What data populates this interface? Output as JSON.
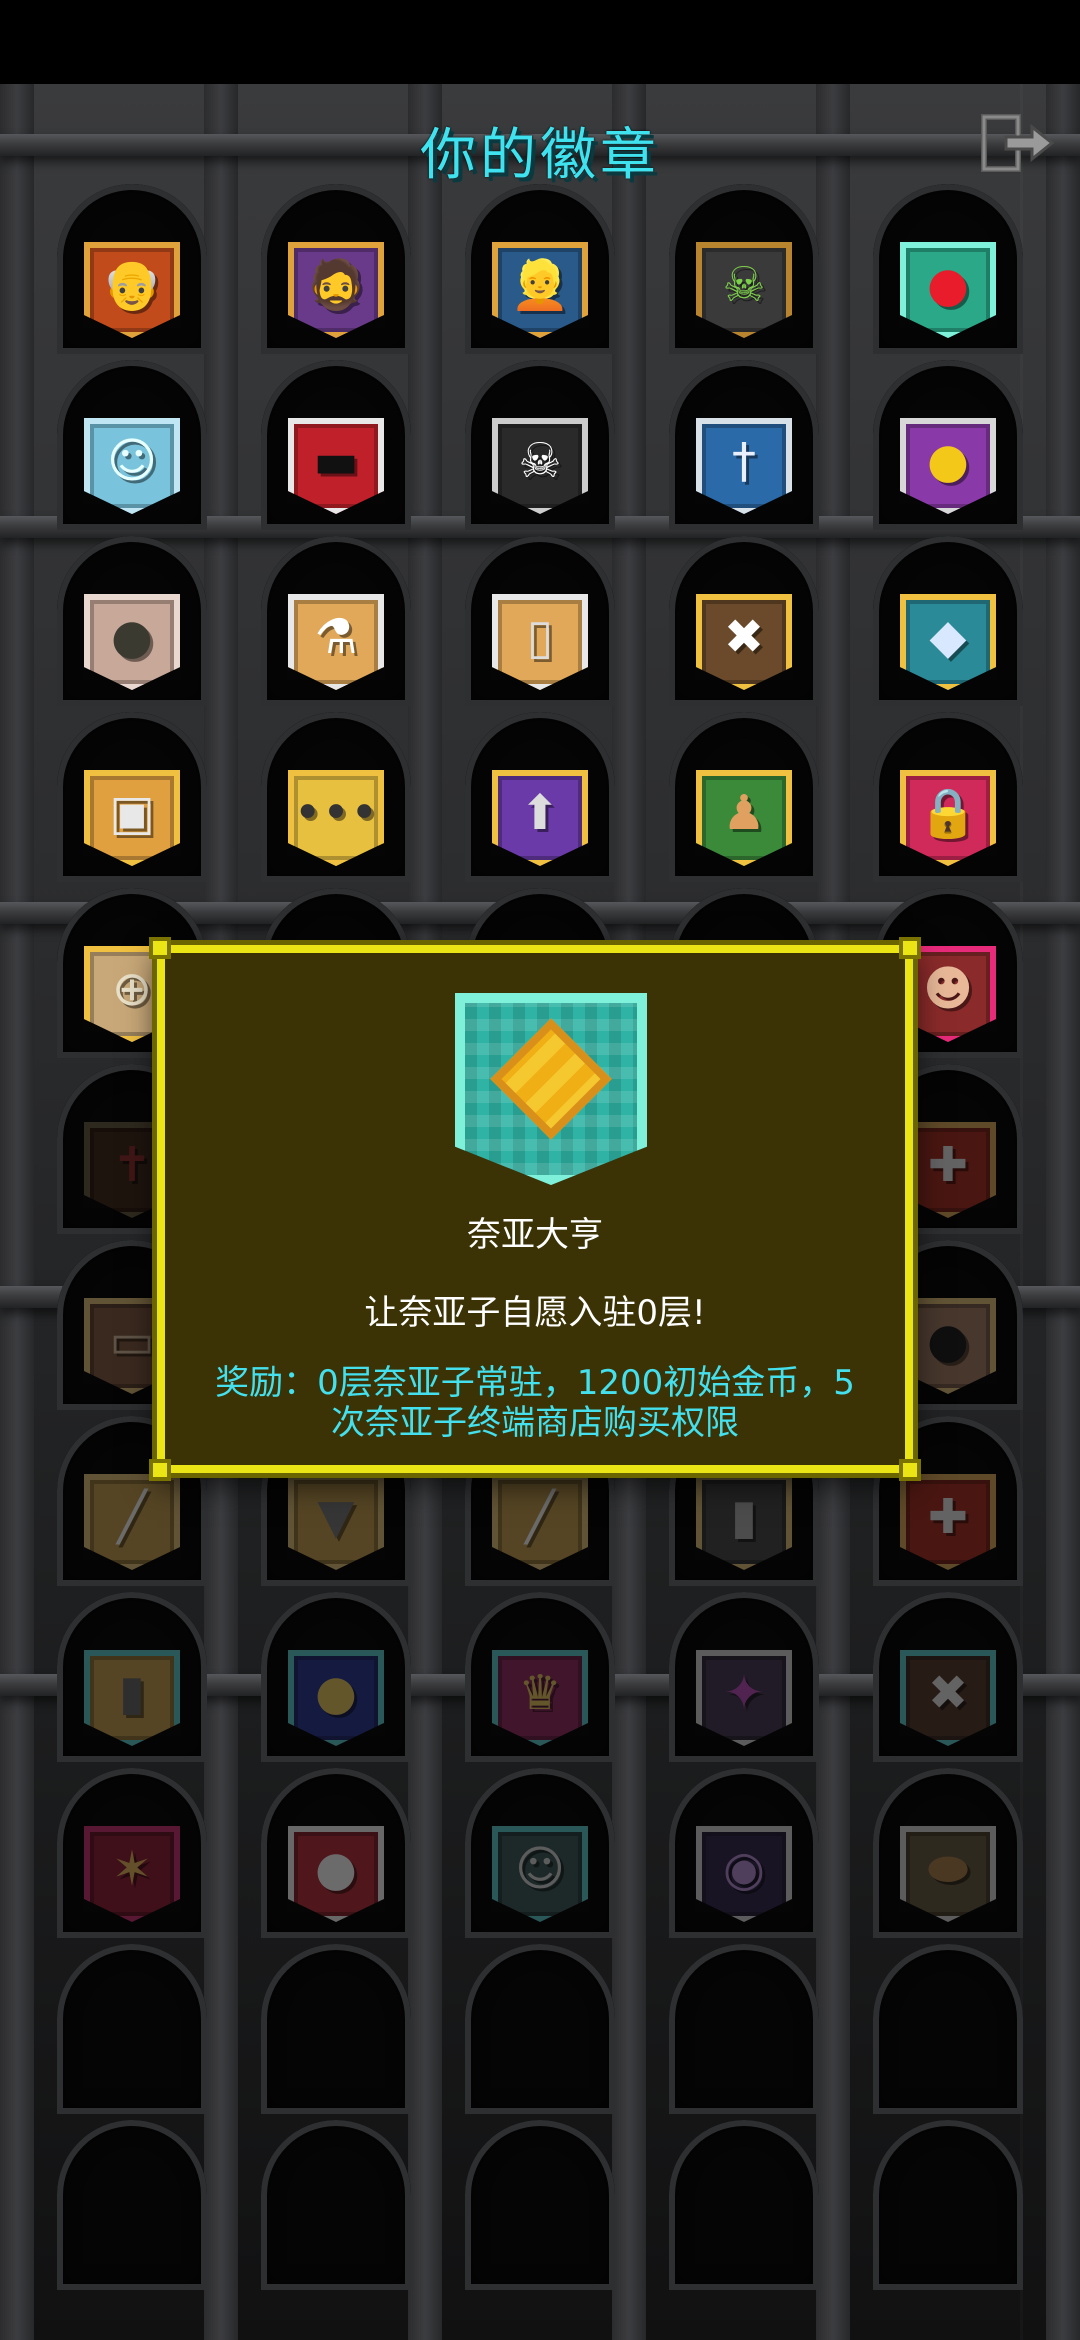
{
  "header": {
    "title": "你的徽章",
    "exit_icon": "exit-door-icon"
  },
  "badges": [
    {
      "name": "badge-old-man",
      "glyph": "👴",
      "frame": "#e0a23a",
      "fill": "#c24b1c",
      "glyph_color": "#ffffff",
      "dim": false
    },
    {
      "name": "badge-rogue",
      "glyph": "🧔",
      "frame": "#e0a23a",
      "fill": "#6a3a8a",
      "glyph_color": "#f4c890",
      "dim": false
    },
    {
      "name": "badge-hero",
      "glyph": "👱",
      "frame": "#e0a23a",
      "fill": "#2a5a8a",
      "glyph_color": "#f0d070",
      "dim": false
    },
    {
      "name": "badge-ghoul",
      "glyph": "☠",
      "frame": "#b8842e",
      "fill": "#3a3a3a",
      "glyph_color": "#7ccf4a",
      "dim": false
    },
    {
      "name": "badge-health-potion",
      "glyph": "●",
      "frame": "#7ff0d9",
      "fill": "#2aa888",
      "glyph_color": "#e81c2a",
      "dim": false
    },
    {
      "name": "badge-ghost",
      "glyph": "☺",
      "frame": "#bfe6f2",
      "fill": "#79c4dc",
      "glyph_color": "#e8ffff",
      "dim": false
    },
    {
      "name": "badge-sunglasses",
      "glyph": "▬",
      "frame": "#e8e8e8",
      "fill": "#c0202a",
      "glyph_color": "#111111",
      "dim": false
    },
    {
      "name": "badge-skull",
      "glyph": "☠",
      "frame": "#cccccc",
      "fill": "#2a2a2a",
      "glyph_color": "#ffffff",
      "dim": false
    },
    {
      "name": "badge-sword",
      "glyph": "†",
      "frame": "#d8e0e8",
      "fill": "#2b6aa8",
      "glyph_color": "#e8f0ff",
      "dim": false
    },
    {
      "name": "badge-gold-coin",
      "glyph": "●",
      "frame": "#d8d8d8",
      "fill": "#8a3aa8",
      "glyph_color": "#f4c818",
      "dim": false
    },
    {
      "name": "badge-pot",
      "glyph": "●",
      "frame": "#e8d8d0",
      "fill": "#c8a898",
      "glyph_color": "#3a3a30",
      "dim": false
    },
    {
      "name": "badge-flask",
      "glyph": "⚗",
      "frame": "#e8e8e8",
      "fill": "#e0a858",
      "glyph_color": "#ffffff",
      "dim": false
    },
    {
      "name": "badge-scroll",
      "glyph": "▯",
      "frame": "#e8e8e8",
      "fill": "#e0a858",
      "glyph_color": "#dddddd",
      "dim": false
    },
    {
      "name": "badge-spider-skull",
      "glyph": "✖",
      "frame": "#f0c040",
      "fill": "#6a4a2a",
      "glyph_color": "#ffffff",
      "dim": false
    },
    {
      "name": "badge-fish",
      "glyph": "◆",
      "frame": "#f0c040",
      "fill": "#2a8a98",
      "glyph_color": "#d8e8ff",
      "dim": false
    },
    {
      "name": "badge-briefcase",
      "glyph": "▣",
      "frame": "#f0c040",
      "fill": "#e0a040",
      "glyph_color": "#e8e8e8",
      "dim": false
    },
    {
      "name": "badge-speech-bubble",
      "glyph": "•••",
      "frame": "#f0c040",
      "fill": "#e8c040",
      "glyph_color": "#333333",
      "dim": false
    },
    {
      "name": "badge-arrow-up",
      "glyph": "⬆",
      "frame": "#f0c040",
      "fill": "#6a3aa8",
      "glyph_color": "#dddddd",
      "dim": false
    },
    {
      "name": "badge-pawn",
      "glyph": "♟",
      "frame": "#f0c040",
      "fill": "#3a8a3a",
      "glyph_color": "#e0a060",
      "dim": false
    },
    {
      "name": "badge-lock",
      "glyph": "🔒",
      "frame": "#f0c040",
      "fill": "#d02a5a",
      "glyph_color": "#444444",
      "dim": false
    },
    {
      "name": "badge-shield-cross",
      "glyph": "⊕",
      "frame": "#f0c040",
      "fill": "#c8a878",
      "glyph_color": "#e8e0c8",
      "dim": false
    },
    {
      "name": "badge-orb",
      "glyph": "●",
      "frame": "#f0c040",
      "fill": "#2a4aa8",
      "glyph_color": "#e88a30",
      "dim": false
    },
    {
      "name": "badge-cloud",
      "glyph": "☁",
      "frame": "#8ed0ee",
      "fill": "#3a8ad0",
      "glyph_color": "#ffffff",
      "dim": false
    },
    {
      "name": "badge-mimic",
      "glyph": "▦",
      "frame": "#44e8e8",
      "fill": "#8a3ad8",
      "glyph_color": "#e82a5a",
      "dim": false
    },
    {
      "name": "badge-warrior",
      "glyph": "☻",
      "frame": "#e82a7a",
      "fill": "#8a2a2a",
      "glyph_color": "#e8b898",
      "dim": false
    },
    {
      "name": "badge-locked-red-figure",
      "glyph": "✝",
      "frame": "#6a5a3a",
      "fill": "#4a2a1a",
      "glyph_color": "#aa2a2a",
      "dim": true
    },
    {
      "name": "badge-locked-skull",
      "glyph": "☠",
      "frame": "#555555",
      "fill": "#2a2a2a",
      "glyph_color": "#aaaaaa",
      "dim": true
    },
    {
      "name": "badge-locked-flame",
      "glyph": "♦",
      "frame": "#a88a3a",
      "fill": "#3a3a3a",
      "glyph_color": "#3ab8d8",
      "dim": true
    },
    {
      "name": "badge-locked-armor",
      "glyph": "▼",
      "frame": "#aaaaaa",
      "fill": "#666666",
      "glyph_color": "#bbbbbb",
      "dim": true
    },
    {
      "name": "badge-locked-cross",
      "glyph": "✚",
      "frame": "#e0a040",
      "fill": "#c02a1a",
      "glyph_color": "#dddddd",
      "dim": true
    },
    {
      "name": "badge-locked-chest",
      "glyph": "▭",
      "frame": "#e0b860",
      "fill": "#8a5a3a",
      "glyph_color": "#d8b890",
      "dim": true
    },
    {
      "name": "badge-locked-face",
      "glyph": "☺",
      "frame": "#e0b860",
      "fill": "#c8a078",
      "glyph_color": "#8a5a4a",
      "dim": true
    },
    {
      "name": "badge-locked-ring",
      "glyph": "◎",
      "frame": "#e0b860",
      "fill": "#6a6a6a",
      "glyph_color": "#dddddd",
      "dim": true
    },
    {
      "name": "badge-locked-tablet",
      "glyph": "▤",
      "frame": "#e0b860",
      "fill": "#3a3a3a",
      "glyph_color": "#e05a5a",
      "dim": true
    },
    {
      "name": "badge-locked-cauldron",
      "glyph": "●",
      "frame": "#e0b860",
      "fill": "#a8785a",
      "glyph_color": "#222222",
      "dim": true
    },
    {
      "name": "badge-locked-blade",
      "glyph": "╱",
      "frame": "#e0b860",
      "fill": "#c89838",
      "glyph_color": "#eeeeee",
      "dim": true
    },
    {
      "name": "badge-locked-shirt",
      "glyph": "▼",
      "frame": "#e0b860",
      "fill": "#c89838",
      "glyph_color": "#777777",
      "dim": true
    },
    {
      "name": "badge-locked-bone",
      "glyph": "╱",
      "frame": "#e0b860",
      "fill": "#c89838",
      "glyph_color": "#eeeeee",
      "dim": true
    },
    {
      "name": "badge-locked-tombstone",
      "glyph": "▮",
      "frame": "#e0b860",
      "fill": "#4a4a4a",
      "glyph_color": "#aaaaaa",
      "dim": true
    },
    {
      "name": "badge-locked-medic",
      "glyph": "✚",
      "frame": "#e0a040",
      "fill": "#c02a1a",
      "glyph_color": "#dddddd",
      "dim": true
    },
    {
      "name": "badge-locked-key",
      "glyph": "▮",
      "frame": "#44c8c8",
      "fill": "#c89838",
      "glyph_color": "#666666",
      "dim": true
    },
    {
      "name": "badge-locked-globe",
      "glyph": "●",
      "frame": "#44c8c8",
      "fill": "#2a3aa8",
      "glyph_color": "#e8c040",
      "dim": true
    },
    {
      "name": "badge-locked-trophy",
      "glyph": "♛",
      "frame": "#44c8c8",
      "fill": "#a82a6a",
      "glyph_color": "#e8c040",
      "dim": true
    },
    {
      "name": "badge-locked-warlock",
      "glyph": "✦",
      "frame": "#cccccc",
      "fill": "#4a3a5a",
      "glyph_color": "#cc44cc",
      "dim": true
    },
    {
      "name": "badge-locked-masked",
      "glyph": "✖",
      "frame": "#44c8c8",
      "fill": "#5a3a2a",
      "glyph_color": "#dddddd",
      "dim": true
    },
    {
      "name": "badge-locked-fighter",
      "glyph": "✶",
      "frame": "#e82a7a",
      "fill": "#a81a3a",
      "glyph_color": "#e8b040",
      "dim": true
    },
    {
      "name": "badge-locked-bomb",
      "glyph": "●",
      "frame": "#e8e8e8",
      "fill": "#d02a3a",
      "glyph_color": "#eeeeee",
      "dim": true
    },
    {
      "name": "badge-locked-wraith",
      "glyph": "☺",
      "frame": "#44c8c8",
      "fill": "#3a5a5a",
      "glyph_color": "#cccccc",
      "dim": true
    },
    {
      "name": "badge-locked-eye",
      "glyph": "◉",
      "frame": "#cccccc",
      "fill": "#3a2a5a",
      "glyph_color": "#bb88dd",
      "dim": true
    },
    {
      "name": "badge-locked-bread",
      "glyph": "⬬",
      "frame": "#cccccc",
      "fill": "#6a5a3a",
      "glyph_color": "#b07a3a",
      "dim": true
    }
  ],
  "popup": {
    "badge_icon": "shield-gold-gem-icon",
    "title": "奈亚大亨",
    "description": "让奈亚子自愿入驻0层!",
    "reward": "奖励：0层奈亚子常驻，1200初始金币，5次奈亚子终端商店购买权限",
    "colors": {
      "border": "#ece515",
      "background": "#3b3305",
      "reward_text": "#44e0ee"
    }
  }
}
